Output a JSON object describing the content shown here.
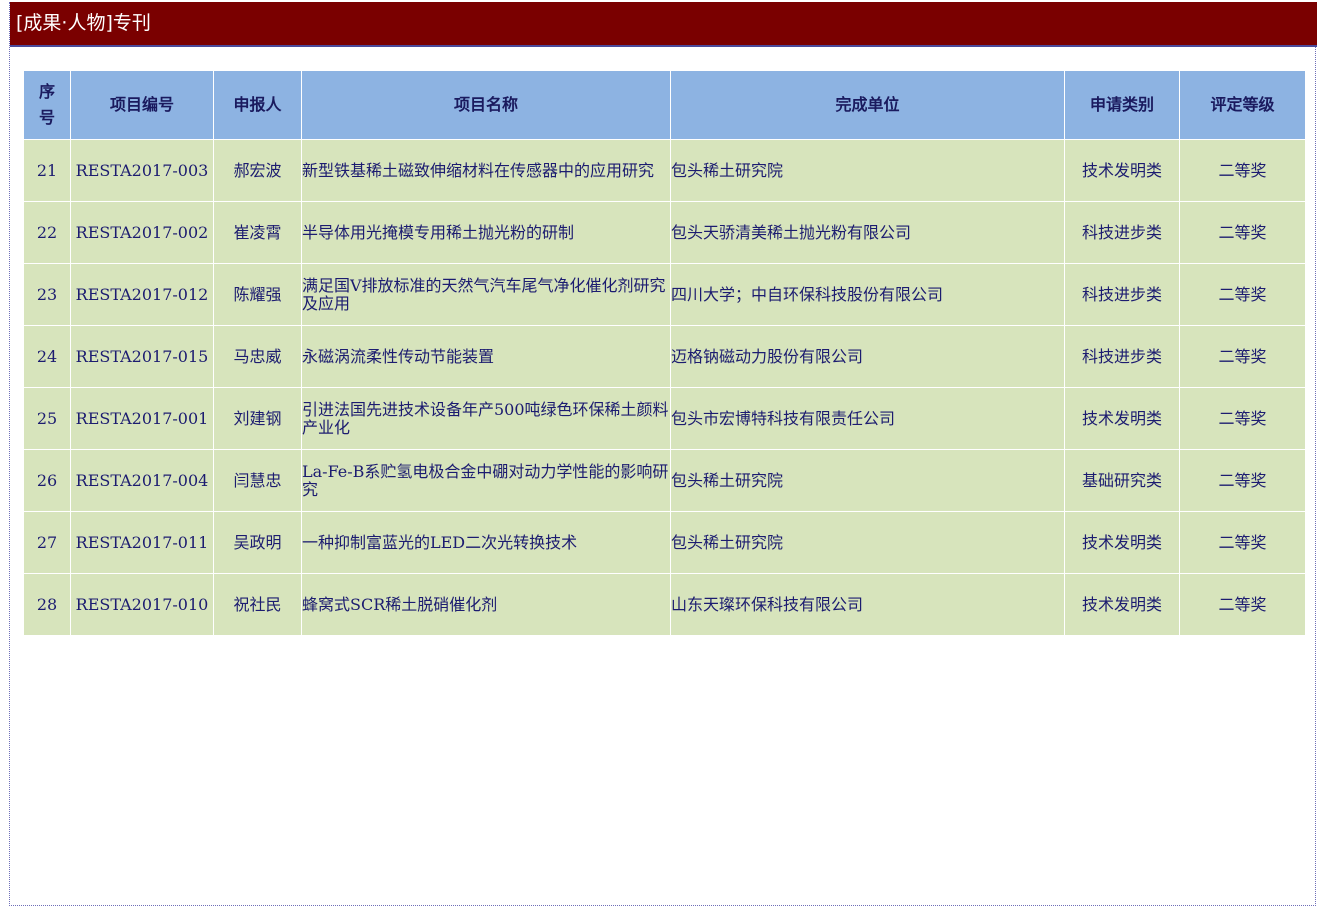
{
  "header": {
    "title": "[成果·人物]专刊"
  },
  "table": {
    "columns": [
      "序号",
      "项目编号",
      "申报人",
      "项目名称",
      "完成单位",
      "申请类别",
      "评定等级"
    ],
    "rows": [
      {
        "seq": "21",
        "code": "RESTA2017-003",
        "applicant": "郝宏波",
        "name": "新型铁基稀土磁致伸缩材料在传感器中的应用研究",
        "unit": "包头稀土研究院",
        "category": "技术发明类",
        "grade": "二等奖"
      },
      {
        "seq": "22",
        "code": "RESTA2017-002",
        "applicant": "崔凌霄",
        "name": "半导体用光掩模专用稀土抛光粉的研制",
        "unit": "包头天骄清美稀土抛光粉有限公司",
        "category": "科技进步类",
        "grade": "二等奖"
      },
      {
        "seq": "23",
        "code": "RESTA2017-012",
        "applicant": "陈耀强",
        "name": "满足国V排放标准的天然气汽车尾气净化催化剂研究及应用",
        "unit": "四川大学；中自环保科技股份有限公司",
        "category": "科技进步类",
        "grade": "二等奖"
      },
      {
        "seq": "24",
        "code": "RESTA2017-015",
        "applicant": "马忠威",
        "name": "永磁涡流柔性传动节能装置",
        "unit": "迈格钠磁动力股份有限公司",
        "category": "科技进步类",
        "grade": "二等奖"
      },
      {
        "seq": "25",
        "code": "RESTA2017-001",
        "applicant": "刘建钢",
        "name": "引进法国先进技术设备年产500吨绿色环保稀土颜料产业化",
        "unit": "包头市宏博特科技有限责任公司",
        "category": "技术发明类",
        "grade": "二等奖"
      },
      {
        "seq": "26",
        "code": "RESTA2017-004",
        "applicant": "闫慧忠",
        "name": "La-Fe-B系贮氢电极合金中硼对动力学性能的影响研究",
        "unit": "包头稀土研究院",
        "category": "基础研究类",
        "grade": "二等奖"
      },
      {
        "seq": "27",
        "code": "RESTA2017-011",
        "applicant": "吴政明",
        "name": "一种抑制富蓝光的LED二次光转换技术",
        "unit": "包头稀土研究院",
        "category": "技术发明类",
        "grade": "二等奖"
      },
      {
        "seq": "28",
        "code": "RESTA2017-010",
        "applicant": "祝社民",
        "name": "蜂窝式SCR稀土脱硝催化剂",
        "unit": "山东天璨环保科技有限公司",
        "category": "技术发明类",
        "grade": "二等奖"
      }
    ]
  },
  "colors": {
    "header_bg": "#7a0000",
    "table_head_bg": "#8db3e2",
    "table_row_bg": "#d7e4bc",
    "text": "#1c1c70"
  }
}
